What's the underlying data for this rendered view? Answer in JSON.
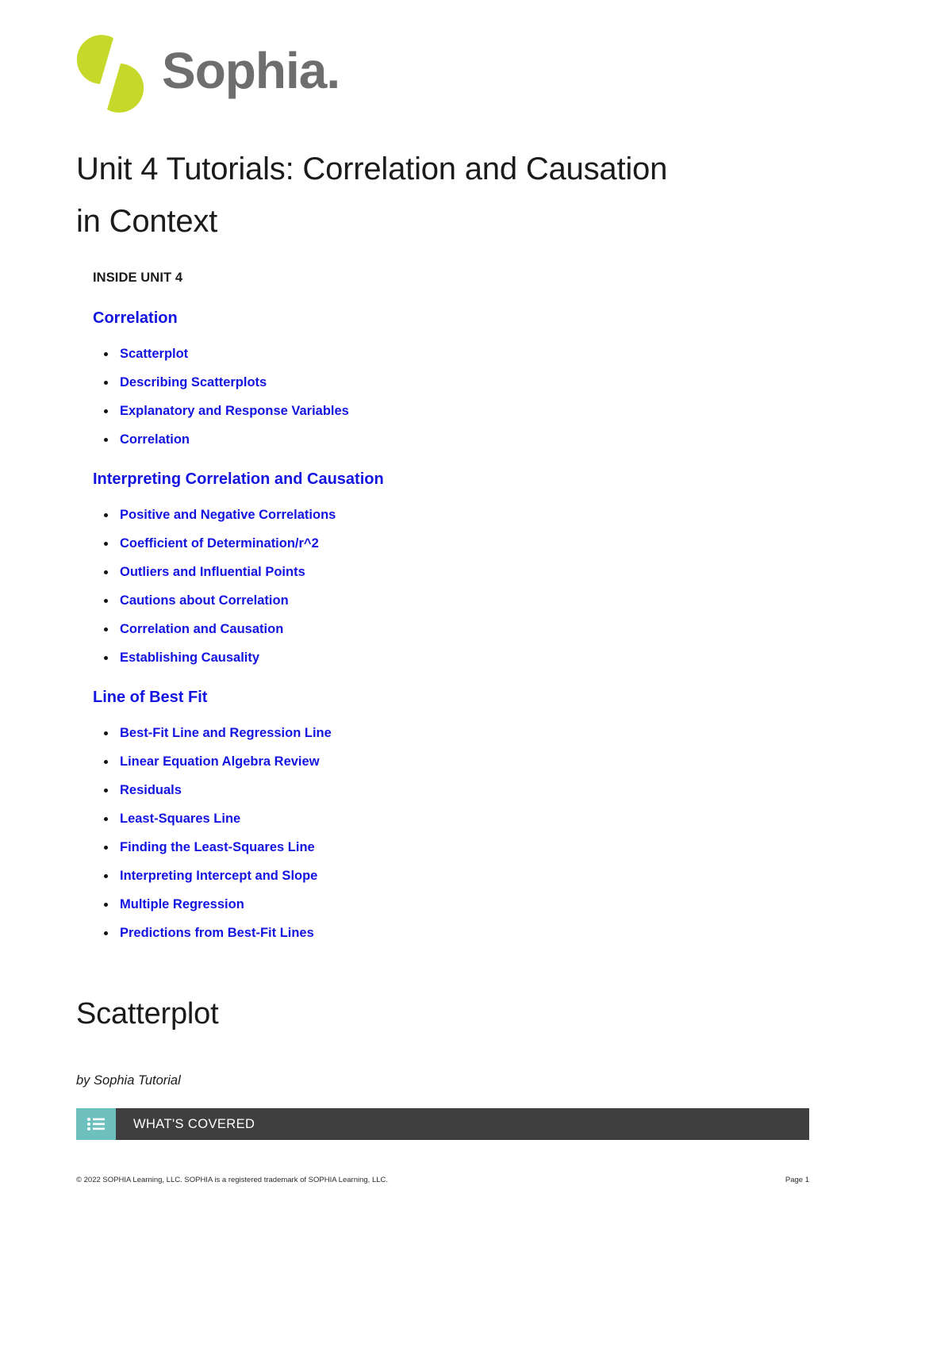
{
  "brand": {
    "name": "Sophia",
    "logo_mark_color": "#c6d92b",
    "wordmark_color": "#6e6e6e",
    "wordmark_text": "Sophia."
  },
  "document": {
    "title": "Unit 4 Tutorials: Correlation and Causation in Context",
    "inside_label": "INSIDE UNIT 4"
  },
  "toc": {
    "link_color": "#1414e0",
    "sections": [
      {
        "heading": "Correlation",
        "items": [
          "Scatterplot",
          "Describing Scatterplots",
          "Explanatory and Response Variables",
          "Correlation"
        ]
      },
      {
        "heading": "Interpreting Correlation and Causation",
        "items": [
          "Positive and Negative Correlations",
          "Coefficient of Determination/r^2",
          "Outliers and Influential Points",
          "Cautions about Correlation",
          "Correlation and Causation",
          "Establishing Causality"
        ]
      },
      {
        "heading": "Line of Best Fit",
        "items": [
          "Best-Fit Line and Regression Line",
          "Linear Equation Algebra Review",
          "Residuals",
          "Least-Squares Line",
          "Finding the Least-Squares Line",
          "Interpreting Intercept and Slope",
          "Multiple Regression",
          "Predictions from Best-Fit Lines"
        ]
      }
    ]
  },
  "lesson": {
    "title": "Scatterplot",
    "byline": "by Sophia Tutorial"
  },
  "covered": {
    "label": "WHAT'S COVERED",
    "icon": "list-icon",
    "icon_bg": "#6dc0bd",
    "bar_bg": "#3f3f3f",
    "text_color": "#ffffff"
  },
  "footer": {
    "copyright": "© 2022 SOPHIA Learning, LLC. SOPHIA is a registered trademark of SOPHIA Learning, LLC.",
    "page": "Page 1"
  }
}
